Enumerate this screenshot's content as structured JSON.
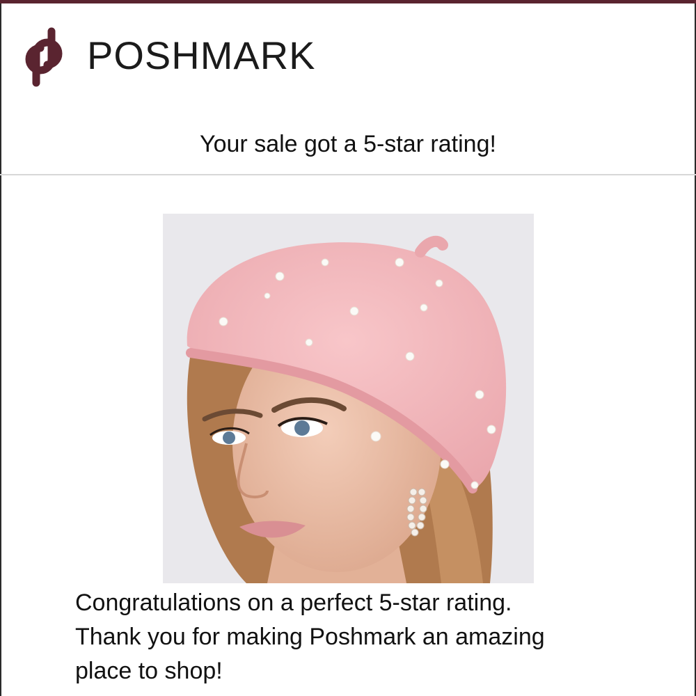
{
  "brand": {
    "name": "POSHMARK",
    "logo_icon": "poshmark-logo-icon",
    "color": "#5a2430"
  },
  "email": {
    "headline": "Your sale got a 5-star rating!",
    "message_lines": [
      "Congratulations on a perfect 5-star rating.",
      "Thank you for making Poshmark an amazing",
      "place to shop!"
    ]
  },
  "product": {
    "image_icon": "product-photo-pink-pearl-beret",
    "hat_color": "#f2b4b8"
  }
}
